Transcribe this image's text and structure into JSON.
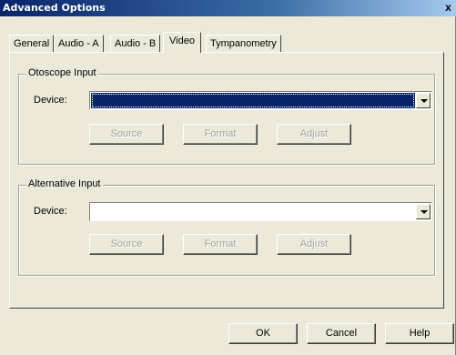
{
  "window": {
    "title": "Advanced Options",
    "close_label": "x"
  },
  "tabs": [
    {
      "label": "General",
      "active": false
    },
    {
      "label": "Audio - A",
      "active": false
    },
    {
      "label": "Audio - B",
      "active": false
    },
    {
      "label": "Video",
      "active": true
    },
    {
      "label": "Tympanometry",
      "active": false
    }
  ],
  "otoscope": {
    "group_label": "Otoscope Input",
    "device_label": "Device:",
    "device_value": "",
    "buttons": {
      "source": "Source",
      "format": "Format",
      "adjust": "Adjust"
    }
  },
  "alternative": {
    "group_label": "Alternative Input",
    "device_label": "Device:",
    "device_value": "",
    "buttons": {
      "source": "Source",
      "format": "Format",
      "adjust": "Adjust"
    }
  },
  "footer": {
    "ok": "OK",
    "cancel": "Cancel",
    "help": "Help"
  },
  "colors": {
    "title_bar": "#0a246a",
    "selection": "#0a246a",
    "face": "#ece9d8"
  }
}
